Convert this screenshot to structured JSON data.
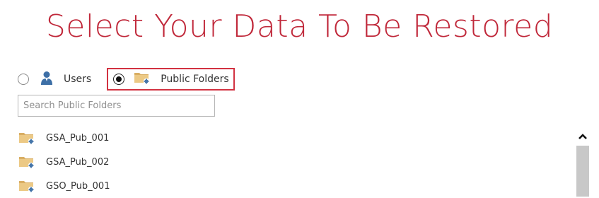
{
  "header": {
    "title": "Select Your Data To Be Restored"
  },
  "scope": {
    "users_label": "Users",
    "public_folders_label": "Public Folders",
    "selected": "public_folders"
  },
  "search": {
    "placeholder": "Search Public Folders",
    "value": ""
  },
  "folders": [
    {
      "name": "GSA_Pub_001",
      "icon": "public-folder-icon"
    },
    {
      "name": "GSA_Pub_002",
      "icon": "public-folder-icon"
    },
    {
      "name": "GSO_Pub_001",
      "icon": "public-folder-icon"
    }
  ],
  "colors": {
    "title": "#c0283a",
    "highlight_border": "#d23241",
    "folder": "#e8c57f",
    "user_icon": "#3d6fa6",
    "scrollbar": "#c8c8c8"
  }
}
